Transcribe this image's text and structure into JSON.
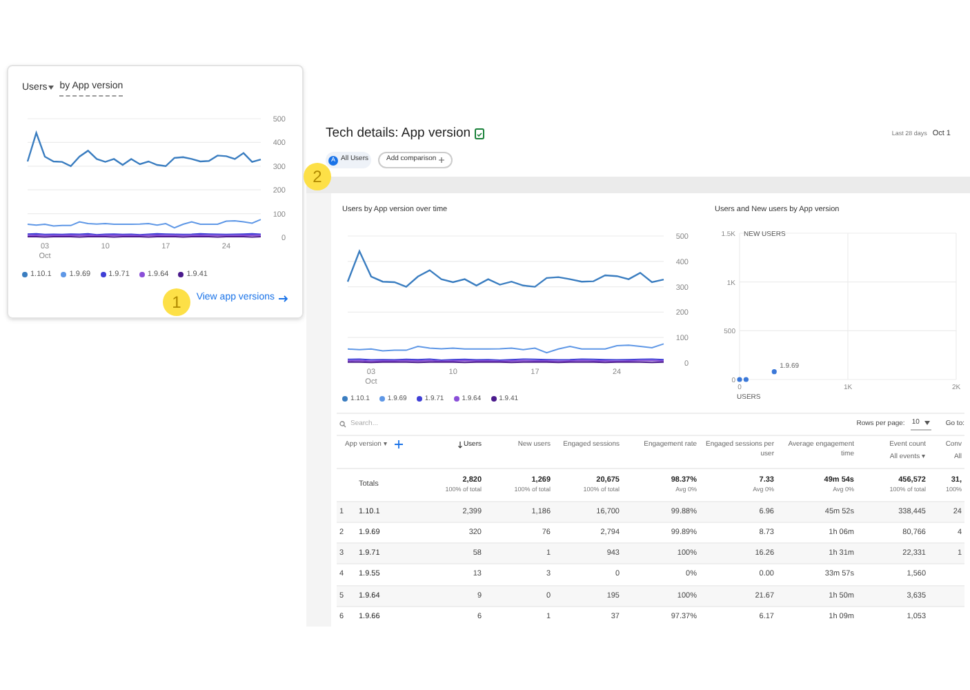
{
  "card": {
    "metric": "Users",
    "dimension": "by App version",
    "month_label": "Oct",
    "link": "View app versions",
    "callout": "1",
    "chart_data": {
      "type": "line",
      "grid": true,
      "x": [
        1,
        2,
        3,
        4,
        5,
        6,
        7,
        8,
        9,
        10,
        11,
        12,
        13,
        14,
        15,
        16,
        17,
        18,
        19,
        20,
        21,
        22,
        23,
        24,
        25,
        26,
        27,
        28
      ],
      "xlim": [
        1,
        28
      ],
      "ylim": [
        0,
        500
      ],
      "yticks": [
        0,
        100,
        200,
        300,
        400,
        500
      ],
      "xticks": [
        {
          "value": 3,
          "label": "03"
        },
        {
          "value": 10,
          "label": "10"
        },
        {
          "value": 17,
          "label": "17"
        },
        {
          "value": 24,
          "label": "24"
        }
      ],
      "series": [
        {
          "name": "1.10.1",
          "color": "#3a7dc0",
          "values": [
            320,
            440,
            340,
            320,
            318,
            300,
            340,
            365,
            330,
            318,
            330,
            305,
            330,
            308,
            320,
            305,
            300,
            335,
            338,
            330,
            320,
            322,
            345,
            342,
            330,
            355,
            318,
            328
          ]
        },
        {
          "name": "1.9.69",
          "color": "#5e97e6",
          "values": [
            55,
            52,
            55,
            48,
            50,
            50,
            65,
            58,
            56,
            58,
            55,
            55,
            55,
            56,
            58,
            52,
            58,
            40,
            55,
            65,
            55,
            55,
            55,
            68,
            70,
            65,
            60,
            75
          ]
        },
        {
          "name": "1.9.71",
          "color": "#3f3fd6",
          "values": [
            14,
            15,
            12,
            13,
            12,
            14,
            13,
            15,
            11,
            13,
            14,
            12,
            13,
            11,
            13,
            15,
            14,
            13,
            12,
            13,
            15,
            14,
            13,
            12,
            13,
            14,
            15,
            13
          ]
        },
        {
          "name": "1.9.64",
          "color": "#8a4fd8",
          "values": [
            8,
            9,
            7,
            8,
            8,
            9,
            8,
            9,
            7,
            8,
            9,
            8,
            8,
            7,
            8,
            9,
            8,
            8,
            7,
            8,
            9,
            8,
            8,
            7,
            8,
            9,
            9,
            8
          ]
        },
        {
          "name": "1.9.41",
          "color": "#4a1a8c",
          "values": [
            3,
            3,
            2,
            3,
            3,
            3,
            2,
            3,
            3,
            3,
            2,
            3,
            3,
            3,
            2,
            3,
            3,
            3,
            2,
            3,
            3,
            3,
            2,
            3,
            3,
            3,
            2,
            3
          ]
        }
      ]
    }
  },
  "page": {
    "title": "Tech details: App version",
    "date_range_label": "Last 28 days",
    "date": "Oct 1",
    "callout": "2",
    "comparisons": [
      {
        "badge": "A",
        "label": "All Users",
        "kind": "segment"
      },
      {
        "label": "Add comparison",
        "kind": "add"
      }
    ]
  },
  "line_chart": {
    "title": "Users by App version over time",
    "month_label": "Oct",
    "chart_data": {
      "type": "line",
      "grid": true,
      "x": [
        1,
        2,
        3,
        4,
        5,
        6,
        7,
        8,
        9,
        10,
        11,
        12,
        13,
        14,
        15,
        16,
        17,
        18,
        19,
        20,
        21,
        22,
        23,
        24,
        25,
        26,
        27,
        28
      ],
      "xlim": [
        1,
        28
      ],
      "ylim": [
        0,
        500
      ],
      "yticks": [
        0,
        100,
        200,
        300,
        400,
        500
      ],
      "xticks": [
        {
          "value": 3,
          "label": "03"
        },
        {
          "value": 10,
          "label": "10"
        },
        {
          "value": 17,
          "label": "17"
        },
        {
          "value": 24,
          "label": "24"
        }
      ],
      "series": [
        {
          "name": "1.10.1",
          "color": "#3a7dc0",
          "values": [
            320,
            440,
            340,
            320,
            318,
            300,
            340,
            365,
            330,
            318,
            330,
            305,
            330,
            308,
            320,
            305,
            300,
            335,
            338,
            330,
            320,
            322,
            345,
            342,
            330,
            355,
            318,
            328
          ]
        },
        {
          "name": "1.9.69",
          "color": "#5e97e6",
          "values": [
            55,
            52,
            55,
            48,
            50,
            50,
            65,
            58,
            56,
            58,
            55,
            55,
            55,
            56,
            58,
            52,
            58,
            40,
            55,
            65,
            55,
            55,
            55,
            68,
            70,
            65,
            60,
            75
          ]
        },
        {
          "name": "1.9.71",
          "color": "#3f3fd6",
          "values": [
            14,
            15,
            12,
            13,
            12,
            14,
            13,
            15,
            11,
            13,
            14,
            12,
            13,
            11,
            13,
            15,
            14,
            13,
            12,
            13,
            15,
            14,
            13,
            12,
            13,
            14,
            15,
            13
          ]
        },
        {
          "name": "1.9.64",
          "color": "#8a4fd8",
          "values": [
            8,
            9,
            7,
            8,
            8,
            9,
            8,
            9,
            7,
            8,
            9,
            8,
            8,
            7,
            8,
            9,
            8,
            8,
            7,
            8,
            9,
            8,
            8,
            7,
            8,
            9,
            9,
            8
          ]
        },
        {
          "name": "1.9.41",
          "color": "#4a1a8c",
          "values": [
            3,
            3,
            2,
            3,
            3,
            3,
            2,
            3,
            3,
            3,
            2,
            3,
            3,
            3,
            2,
            3,
            3,
            3,
            2,
            3,
            3,
            3,
            2,
            3,
            3,
            3,
            2,
            3
          ]
        }
      ]
    }
  },
  "scatter_chart": {
    "title": "Users and New users by App version",
    "chart_data": {
      "type": "scatter",
      "grid": true,
      "xlabel": "USERS",
      "ylabel": "NEW USERS",
      "xlim": [
        0,
        2000
      ],
      "ylim": [
        0,
        1500
      ],
      "xticks": [
        {
          "value": 0,
          "label": "0"
        },
        {
          "value": 1000,
          "label": "1K"
        },
        {
          "value": 2000,
          "label": "2K"
        }
      ],
      "yticks": [
        {
          "value": 0,
          "label": "0"
        },
        {
          "value": 500,
          "label": "500"
        },
        {
          "value": 1000,
          "label": "1K"
        },
        {
          "value": 1500,
          "label": "1.5K"
        }
      ],
      "series": [
        {
          "color": "#3b78d8",
          "x": [
            320,
            60,
            0
          ],
          "values": [
            80,
            0,
            0
          ]
        }
      ],
      "annotations": [
        {
          "text": "1.9.69",
          "x": 320,
          "y": 80
        }
      ]
    }
  },
  "table": {
    "search_placeholder": "Search...",
    "rows_per_page_label": "Rows per page:",
    "rows_per_page": "10",
    "goto_label": "Go to:",
    "totals_label": "Totals",
    "columns": [
      {
        "label": "App version ▾",
        "sorted": false
      },
      {
        "label": "Users",
        "sorted": true
      },
      {
        "label": "New users",
        "sorted": false
      },
      {
        "label": "Engaged sessions",
        "sorted": false
      },
      {
        "label": "Engagement rate",
        "sorted": false
      },
      {
        "label": "Engaged sessions per user",
        "sorted": false
      },
      {
        "label": "Average engagement time",
        "sorted": false
      },
      {
        "label": "Event count",
        "sub": "All events ▾",
        "sorted": false
      },
      {
        "label": "Conv",
        "sub": "All",
        "sorted": false
      }
    ],
    "totals": [
      {
        "value": "2,820",
        "sub": "100% of total"
      },
      {
        "value": "1,269",
        "sub": "100% of total"
      },
      {
        "value": "20,675",
        "sub": "100% of total"
      },
      {
        "value": "98.37%",
        "sub": "Avg 0%"
      },
      {
        "value": "7.33",
        "sub": "Avg 0%"
      },
      {
        "value": "49m 54s",
        "sub": "Avg 0%"
      },
      {
        "value": "456,572",
        "sub": "100% of total"
      },
      {
        "value": "31,",
        "sub": "100%"
      }
    ],
    "rows": [
      {
        "index": "1",
        "cells": [
          "1.10.1",
          "2,399",
          "1,186",
          "16,700",
          "99.88%",
          "6.96",
          "45m 52s",
          "338,445",
          "24"
        ]
      },
      {
        "index": "2",
        "cells": [
          "1.9.69",
          "320",
          "76",
          "2,794",
          "99.89%",
          "8.73",
          "1h 06m",
          "80,766",
          "4"
        ]
      },
      {
        "index": "3",
        "cells": [
          "1.9.71",
          "58",
          "1",
          "943",
          "100%",
          "16.26",
          "1h 31m",
          "22,331",
          "1"
        ]
      },
      {
        "index": "4",
        "cells": [
          "1.9.55",
          "13",
          "3",
          "0",
          "0%",
          "0.00",
          "33m 57s",
          "1,560"
        ]
      },
      {
        "index": "5",
        "cells": [
          "1.9.64",
          "9",
          "0",
          "195",
          "100%",
          "21.67",
          "1h 50m",
          "3,635"
        ]
      },
      {
        "index": "6",
        "cells": [
          "1.9.66",
          "6",
          "1",
          "37",
          "97.37%",
          "6.17",
          "1h 09m",
          "1,053"
        ]
      }
    ]
  }
}
